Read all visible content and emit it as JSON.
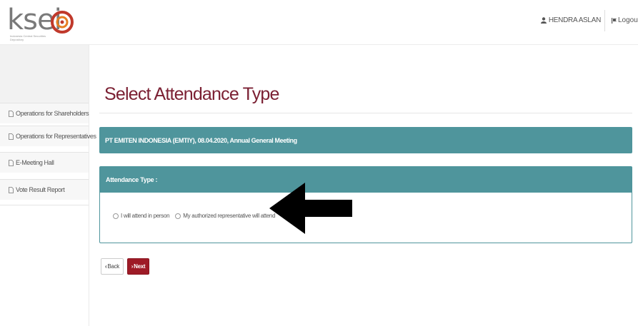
{
  "header": {
    "logo_text": "ksei",
    "logo_subtitle": "Indonesia Central Securities Depository",
    "user_name": "HENDRA ASLAN",
    "logout_label": "Logout"
  },
  "sidebar": {
    "items": [
      {
        "label": "Operations for Shareholders"
      },
      {
        "label": "Operations for Representatives"
      },
      {
        "label": "E-Meeting Hall"
      },
      {
        "label": "Vote Result Report"
      }
    ]
  },
  "main": {
    "title": "Select Attendance Type",
    "meeting_info": "PT EMITEN INDONESIA (EMTIY), 08.04.2020, Annual General Meeting",
    "attendance_panel": {
      "heading": "Attendance Type :",
      "options": [
        {
          "label": "I will attend in person",
          "selected": false
        },
        {
          "label": "My authorized representative will attend",
          "selected": false
        }
      ]
    },
    "buttons": {
      "back_label": "Back",
      "next_label": "Next"
    }
  },
  "colors": {
    "teal_bar": "#4f959c",
    "title_maroon": "#7b2033",
    "next_button": "#9e1b27"
  },
  "annotation": {
    "arrow_icon": "left-arrow-icon"
  }
}
